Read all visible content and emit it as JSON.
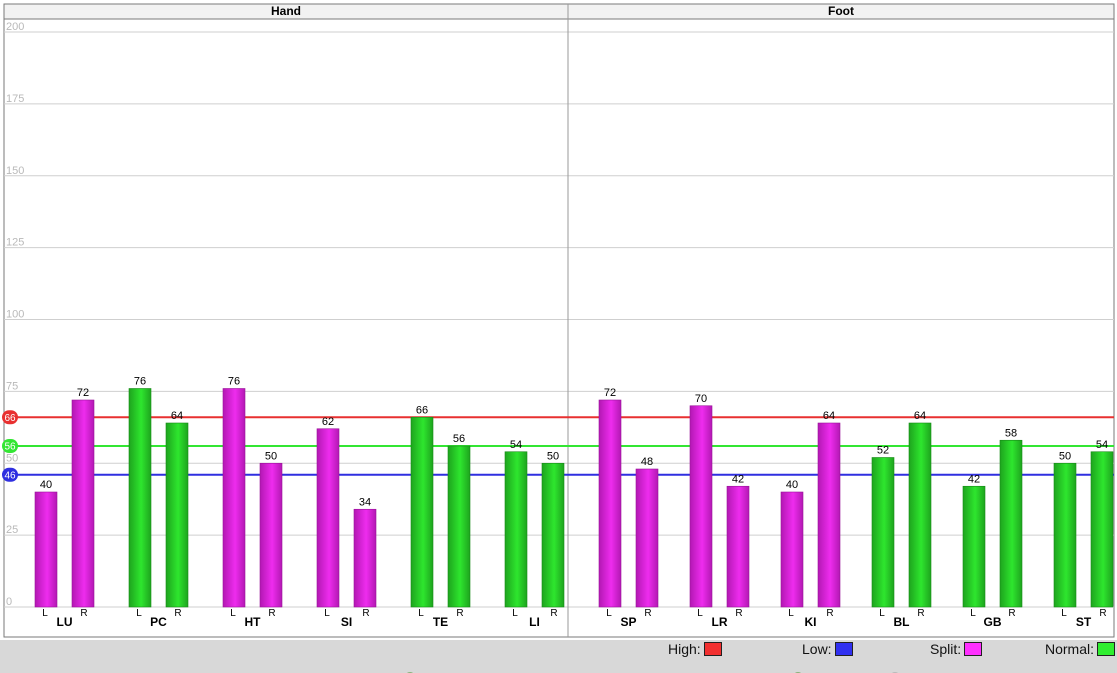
{
  "chart_data": {
    "type": "bar",
    "panels": [
      {
        "title": "Hand",
        "categories": [
          "LU",
          "PC",
          "HT",
          "SI",
          "TE",
          "LI"
        ],
        "L": [
          40,
          76,
          76,
          62,
          66,
          54
        ],
        "R": [
          72,
          64,
          50,
          34,
          56,
          50
        ]
      },
      {
        "title": "Foot",
        "categories": [
          "SP",
          "LR",
          "KI",
          "BL",
          "GB",
          "ST"
        ],
        "L": [
          72,
          70,
          40,
          52,
          42,
          50
        ],
        "R": [
          48,
          42,
          64,
          64,
          58,
          54
        ]
      }
    ],
    "side_labels": [
      "L",
      "R"
    ],
    "ylim": [
      0,
      200
    ],
    "yticks": [
      0,
      25,
      50,
      75,
      100,
      125,
      150,
      175,
      200
    ],
    "reference_lines": [
      {
        "value": 66,
        "label": "66",
        "color": "#e83030"
      },
      {
        "value": 56,
        "label": "56",
        "color": "#33e633"
      },
      {
        "value": 46,
        "label": "46",
        "color": "#2f2fe0"
      }
    ],
    "bar_colors": {
      "normal": "#2ee62e",
      "split": "#ee2cee"
    },
    "bar_classification": {
      "Hand": {
        "L": [
          "split",
          "normal",
          "split",
          "split",
          "normal",
          "normal"
        ],
        "R": [
          "split",
          "normal",
          "split",
          "split",
          "normal",
          "normal"
        ]
      },
      "Foot": {
        "L": [
          "split",
          "split",
          "split",
          "normal",
          "normal",
          "normal"
        ],
        "R": [
          "split",
          "split",
          "split",
          "normal",
          "normal",
          "normal"
        ]
      }
    },
    "grid": true,
    "legend_position": "bottom-right"
  },
  "legend": [
    {
      "label": "High:",
      "color": "#f23030"
    },
    {
      "label": "Low:",
      "color": "#3030f0"
    },
    {
      "label": "Split:",
      "color": "#ff30ff"
    },
    {
      "label": "Normal:",
      "color": "#30ee30"
    }
  ]
}
